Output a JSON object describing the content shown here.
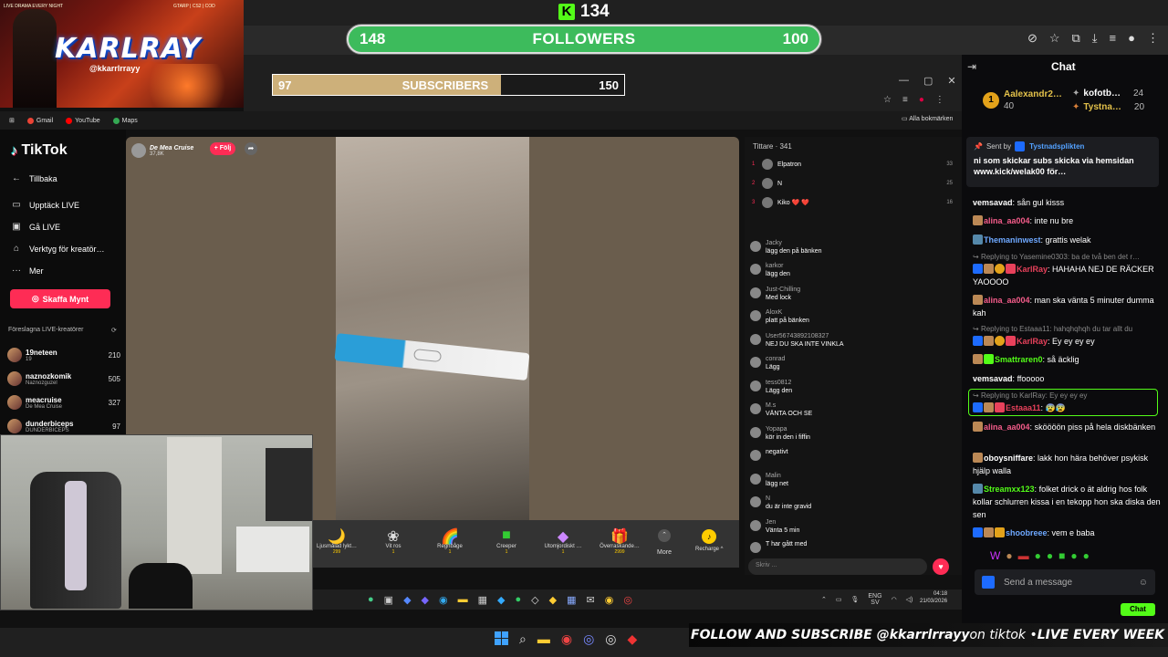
{
  "overlay": {
    "banner": {
      "brand": "KARLRAY",
      "handle": "@kkarrlrrayy",
      "tagline_left": "LIVE DRAMA EVERY NIGHT",
      "tagline_right": "GTARP | CS2 | COD"
    },
    "kick_count": "134",
    "followers": {
      "current": "148",
      "label": "FOLLOWERS",
      "goal": "100"
    },
    "subscribers": {
      "current": "97",
      "label": "SUBSCRIBERS",
      "goal": "150",
      "progress": 0.65
    },
    "ticker": {
      "left": "FOLLOW AND SUBSCRIBE @kkarrlrrayy",
      "mid": " on tiktok • ",
      "right": "LIVE EVERY WEEK"
    }
  },
  "browser": {
    "bookmarks": [
      "Gmail",
      "YouTube",
      "Maps"
    ],
    "all_bookmarks": "Alla bokmärken"
  },
  "tiktok": {
    "logo": "TikTok",
    "nav": [
      "Tillbaka",
      "Upptäck LIVE",
      "Gå LIVE",
      "Verktyg för kreatör…",
      "Mer"
    ],
    "coins_button": "Skaffa Mynt",
    "suggested_header": "Föreslagna LIVE-kreatörer",
    "creators": [
      {
        "name": "19neteen",
        "sub": "19",
        "count": "210"
      },
      {
        "name": "naznozkomik",
        "sub": "Naznozguzel",
        "count": "505"
      },
      {
        "name": "meacruise",
        "sub": "De Mea Cruise",
        "count": "327"
      },
      {
        "name": "dunderbiceps",
        "sub": "DUNDERBICEPS",
        "count": "97"
      }
    ],
    "streamer": {
      "name": "De Mea Cruise",
      "viewers": "37,8K",
      "follow": "+ Följ"
    },
    "viewers_header": "Tittare · 341",
    "top_viewers": [
      {
        "rank": "1",
        "name": "Elpatron",
        "score": "33"
      },
      {
        "rank": "2",
        "name": "N",
        "score": "25"
      },
      {
        "rank": "3",
        "name": "Kiko ❤️ ❤️",
        "score": "16"
      }
    ],
    "messages": [
      {
        "user": "Jacky",
        "text": "lägg den på bänken"
      },
      {
        "user": "karkor",
        "text": "lägg den"
      },
      {
        "user": "Just-Chilling",
        "text": "Med lock"
      },
      {
        "user": "AloxK",
        "text": "platt på bänken"
      },
      {
        "user": "User5674389210832​7",
        "text": "NEJ DU SKA INTE VINKLA"
      },
      {
        "user": "conrad",
        "text": "Lägg"
      },
      {
        "user": "tess0812",
        "text": "Lägg den"
      },
      {
        "user": "M.s",
        "text": "VÄNTA OCH SE"
      },
      {
        "user": "Yopapa",
        "text": "kör in den i fiffin"
      },
      {
        "user": "",
        "text": "negativt"
      },
      {
        "user": "Malin",
        "text": "lägg net"
      },
      {
        "user": "N",
        "text": "du är inte gravid"
      },
      {
        "user": "Jen",
        "text": "Vänta 5 min"
      },
      {
        "user": "T",
        "text": "har gått med"
      }
    ],
    "chat_placeholder": "Skriv ...",
    "gifts": [
      {
        "name": "Ljusmålad lykt…",
        "price": "299"
      },
      {
        "name": "Vit ros",
        "price": "1"
      },
      {
        "name": "Regnbåge",
        "price": "1"
      },
      {
        "name": "Creeper",
        "price": "1"
      },
      {
        "name": "Utomjordiskt …",
        "price": "1"
      },
      {
        "name": "Överraskande…",
        "price": "2999"
      }
    ],
    "more": "More",
    "recharge": "Recharge"
  },
  "kick_chat": {
    "title": "Chat",
    "top_gifters": [
      {
        "name": "Aalexandr2…",
        "value": "40"
      },
      {
        "name": "kofotb…",
        "value": "24"
      },
      {
        "name": "Tystna…",
        "value": "20"
      }
    ],
    "pinned": {
      "sent_by": "Sent by",
      "name": "Tystnadsplikten",
      "text": "ni som skickar subs skicka via hemsidan www.kick/welak00 för…"
    },
    "messages": [
      {
        "user": "vemsavad",
        "color": "#ffffff",
        "text": "sån gul kisss"
      },
      {
        "user": "alina_aa004",
        "color": "#f45c8a",
        "text": "inte nu bre"
      },
      {
        "user": "Themaninwest",
        "color": "#6ea8ff",
        "text": "grattis welak"
      },
      {
        "reply": "Replying to Yasemine0303: ba de två ben det r…"
      },
      {
        "user": "KarlRay",
        "color": "#e8415b",
        "text": "HAHAHA NEJ DE RÄCKER YAOOOO"
      },
      {
        "user": "alina_aa004",
        "color": "#f45c8a",
        "text": "man ska vänta 5 minuter dumma kah"
      },
      {
        "reply": "Replying to Estaaa11: hahqhqhqh du tar allt du"
      },
      {
        "user": "KarlRay",
        "color": "#e8415b",
        "text": "Ey ey ey ey"
      },
      {
        "user": "Smattraren0",
        "color": "#53fc18",
        "text": "så äcklig"
      },
      {
        "user": "vemsavad",
        "color": "#ffffff",
        "text": "ffooooo"
      },
      {
        "reply": "Replying to KarlRay: Ey ey ey ey"
      },
      {
        "user": "Estaaa11",
        "color": "#e8415b",
        "text": "😰😰"
      },
      {
        "user": "alina_aa004",
        "color": "#f45c8a",
        "text": "sköööön piss på hela diskbänken"
      },
      {
        "user": "oboysniffare",
        "color": "#ffffff",
        "text": "lakk hon hära behöver psykisk hjälp walla"
      },
      {
        "user": "Streamxx123",
        "color": "#53fc18",
        "text": "folket drick o ät aldrig hos folk kollar schlurren kissa i en tekopp hon ska diska den sen"
      },
      {
        "user": "shoobreee",
        "color": "#6ea8ff",
        "text": "vem e baba"
      }
    ],
    "input_placeholder": "Send a message",
    "chat_button": "Chat"
  },
  "system": {
    "lang": "ENG",
    "region": "SV",
    "time": "04:18",
    "date": "21/03/2026"
  }
}
